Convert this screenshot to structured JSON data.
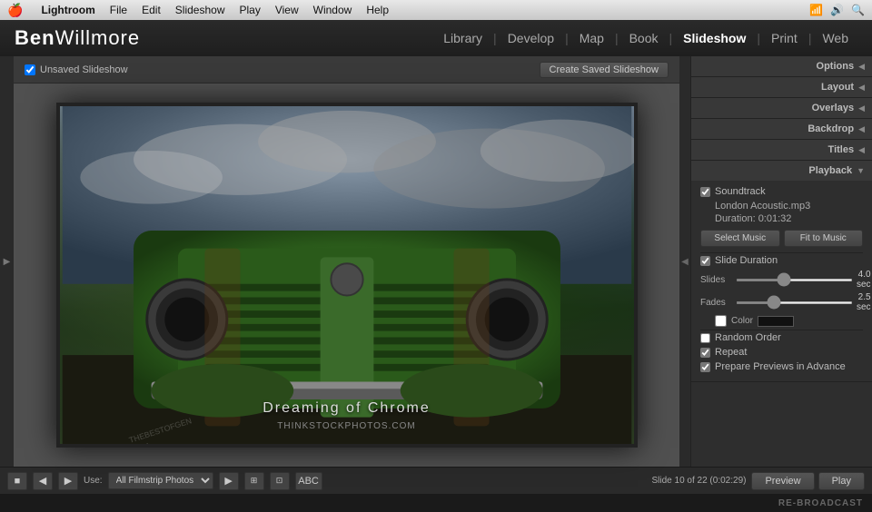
{
  "menubar": {
    "apple": "🍎",
    "app": "Lightroom",
    "menus": [
      "File",
      "Edit",
      "Slideshow",
      "Play",
      "View",
      "Window",
      "Help"
    ]
  },
  "titlebar": {
    "brand_bold": "Ben",
    "brand_light": "Willmore",
    "nav_links": [
      {
        "label": "Library",
        "active": false
      },
      {
        "label": "Develop",
        "active": false
      },
      {
        "label": "Map",
        "active": false
      },
      {
        "label": "Book",
        "active": false
      },
      {
        "label": "Slideshow",
        "active": true
      },
      {
        "label": "Print",
        "active": false
      },
      {
        "label": "Web",
        "active": false
      }
    ]
  },
  "slideshow_toolbar": {
    "unsaved_label": "Unsaved Slideshow",
    "create_btn": "Create Saved Slideshow"
  },
  "slide": {
    "caption": "Dreaming of Chrome",
    "subcaption": "THINKSTOCKPHOTOS.COM",
    "watermark": "THEBESTOFGEN\nCOM"
  },
  "right_panel": {
    "sections": [
      {
        "label": "Options",
        "arrow": "◀"
      },
      {
        "label": "Layout",
        "arrow": "◀"
      },
      {
        "label": "Overlays",
        "arrow": "◀"
      },
      {
        "label": "Backdrop",
        "arrow": "◀"
      },
      {
        "label": "Titles",
        "arrow": "◀"
      },
      {
        "label": "Playback",
        "arrow": "▼"
      }
    ],
    "playback": {
      "soundtrack_checked": true,
      "soundtrack_label": "Soundtrack",
      "music_file": "London Acoustic.mp3",
      "duration_label": "Duration: 0:01:32",
      "select_music_btn": "Select Music",
      "fit_to_music_btn": "Fit to Music",
      "slide_duration_checked": true,
      "slide_duration_label": "Slide Duration",
      "slides_label": "Slides",
      "slides_value": "4.0 sec",
      "fades_label": "Fades",
      "fades_value": "2.5 sec",
      "color_label": "Color",
      "random_order_checked": false,
      "random_order_label": "Random Order",
      "repeat_checked": true,
      "repeat_label": "Repeat",
      "prepare_checked": true,
      "prepare_label": "Prepare Previews in Advance"
    }
  },
  "footer": {
    "stop_icon": "■",
    "prev_icon": "◀",
    "next_icon": "▶",
    "play_icon": "▶",
    "use_label": "Use:",
    "use_value": "All Filmstrip Photos",
    "abc_label": "ABC",
    "slide_info": "Slide 10 of 22 (0:02:29)",
    "preview_btn": "Preview",
    "play_btn": "Play"
  },
  "rebroadcast": {
    "label": "RE-BROADCAST"
  }
}
